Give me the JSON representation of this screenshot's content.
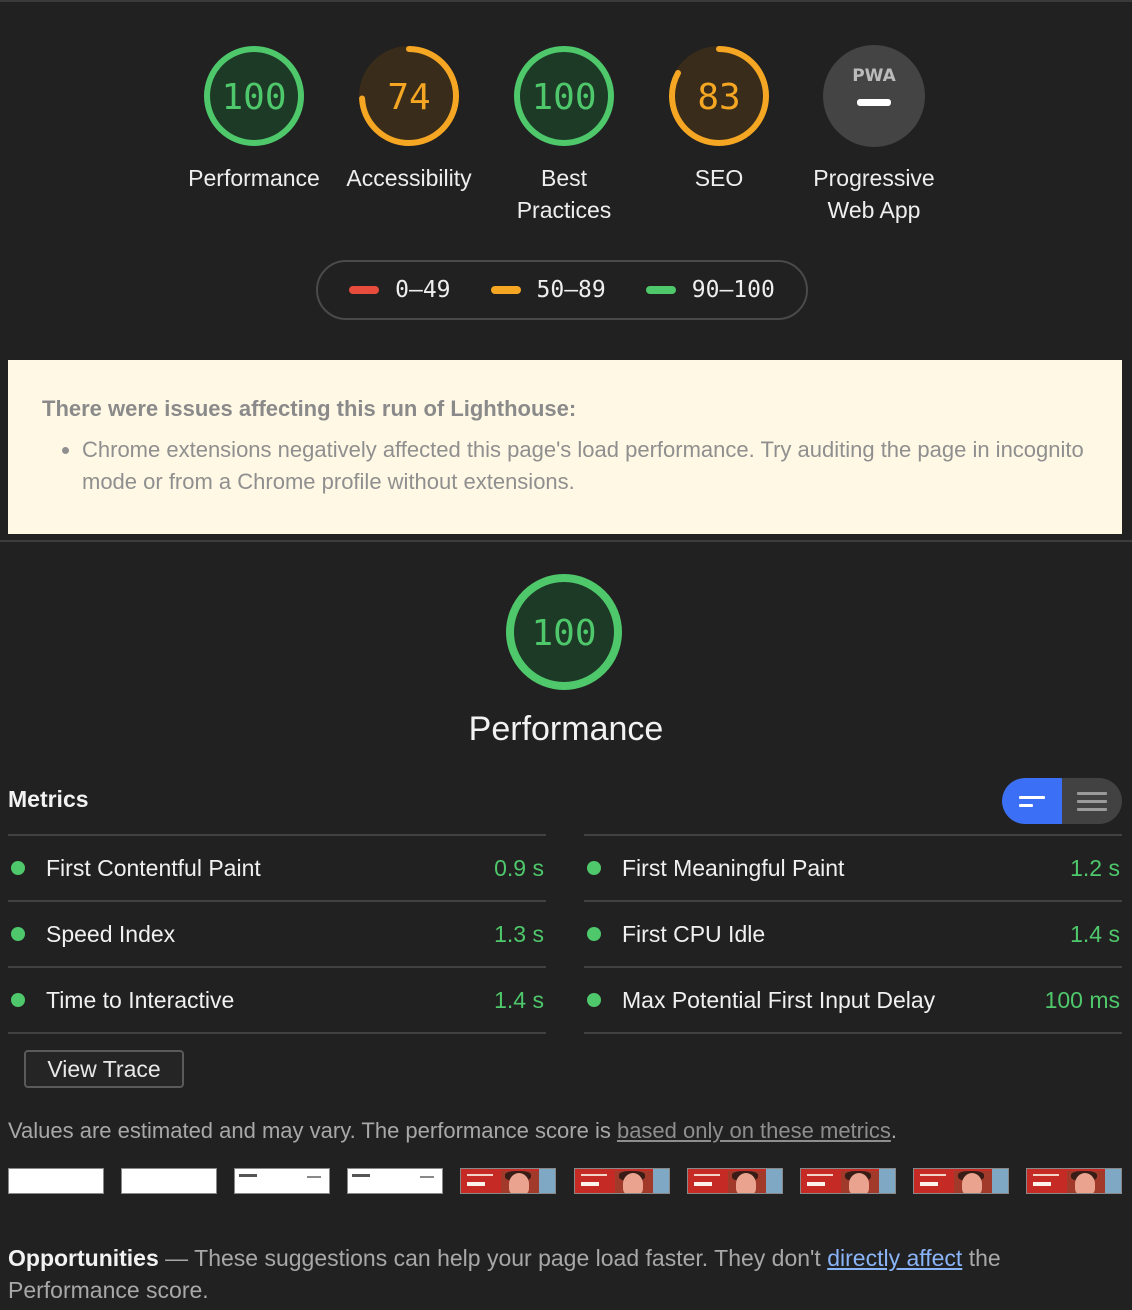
{
  "gauges": [
    {
      "score": "100",
      "label": "Performance",
      "color": "#4ec86b",
      "fraction": 1.0
    },
    {
      "score": "74",
      "label": "Accessibility",
      "color": "#f5a623",
      "fraction": 0.74
    },
    {
      "score": "100",
      "label": "Best Practices",
      "color": "#4ec86b",
      "fraction": 1.0
    },
    {
      "score": "83",
      "label": "SEO",
      "color": "#f5a623",
      "fraction": 0.83
    },
    {
      "label": "Progressive Web App",
      "badge": "PWA"
    }
  ],
  "legend": {
    "low": {
      "label": "0–49",
      "color": "#e74c3c"
    },
    "mid": {
      "label": "50–89",
      "color": "#f5a623"
    },
    "high": {
      "label": "90–100",
      "color": "#4ec86b"
    }
  },
  "warning": {
    "title": "There were issues affecting this run of Lighthouse:",
    "item": "Chrome extensions negatively affected this page's load performance. Try auditing the page in incognito mode or from a Chrome profile without extensions."
  },
  "performance": {
    "score": "100",
    "title": "Performance",
    "metrics_title": "Metrics",
    "metrics_left": [
      {
        "name": "First Contentful Paint",
        "value": "0.9 s"
      },
      {
        "name": "Speed Index",
        "value": "1.3 s"
      },
      {
        "name": "Time to Interactive",
        "value": "1.4 s"
      }
    ],
    "metrics_right": [
      {
        "name": "First Meaningful Paint",
        "value": "1.2 s"
      },
      {
        "name": "First CPU Idle",
        "value": "1.4 s"
      },
      {
        "name": "Max Potential First Input Delay",
        "value": "100 ms"
      }
    ],
    "view_trace": "View Trace",
    "estimate_text": "Values are estimated and may vary. The performance score is ",
    "estimate_link": "based only on these metrics",
    "estimate_end": "."
  },
  "opportunities": {
    "title": "Opportunities",
    "dash": " — ",
    "text": "These suggestions can help your page load faster. They don't ",
    "link": "directly affect",
    "text_end": " the Performance score."
  },
  "colors": {
    "pass": "#4ec86b",
    "average": "#f5a623",
    "fail": "#e74c3c",
    "accent": "#3b6ff5"
  }
}
